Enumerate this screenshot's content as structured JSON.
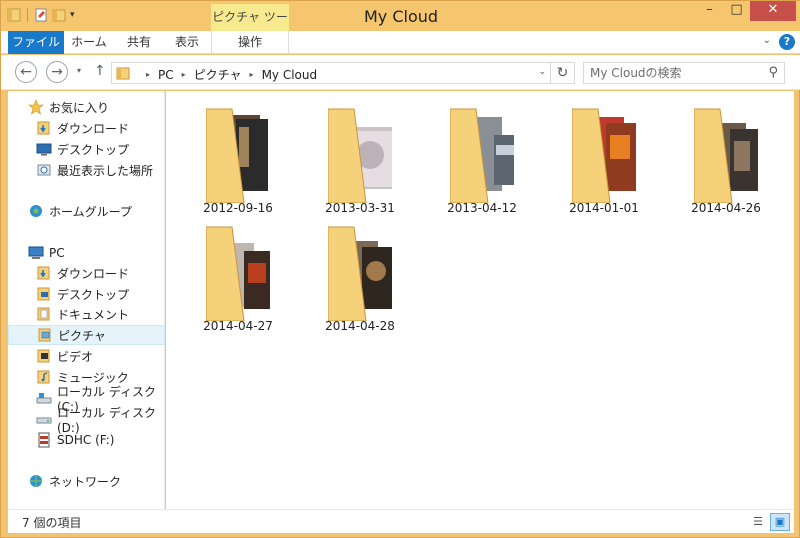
{
  "window": {
    "title": "My Cloud",
    "context_tab_group": "ピクチャ ツール",
    "buttons": {
      "minimize": "–",
      "maximize": "□",
      "close": "✕"
    }
  },
  "quick_access": {
    "dropdown": "▾"
  },
  "ribbon": {
    "tabs": [
      "ファイル",
      "ホーム",
      "共有",
      "表示",
      "操作"
    ],
    "expand": "⌄",
    "help": "?"
  },
  "navigation": {
    "back": "←",
    "forward": "→",
    "recent": "▾",
    "up": "↑",
    "breadcrumb": [
      "PC",
      "ピクチャ",
      "My Cloud"
    ],
    "separator": "▸",
    "address_dropdown": "⌄",
    "refresh": "↻",
    "search_placeholder": "My Cloudの検索",
    "search_icon": "⚲"
  },
  "nav_pane": {
    "favorites": {
      "label": "お気に入り",
      "items": [
        "ダウンロード",
        "デスクトップ",
        "最近表示した場所"
      ]
    },
    "homegroup": {
      "label": "ホームグループ"
    },
    "pc": {
      "label": "PC",
      "items": [
        "ダウンロード",
        "デスクトップ",
        "ドキュメント",
        "ピクチャ",
        "ビデオ",
        "ミュージック",
        "ローカル ディスク (C:)",
        "ローカル ディスク (D:)",
        "SDHC (F:)"
      ],
      "selected": "ピクチャ"
    },
    "network": {
      "label": "ネットワーク"
    }
  },
  "folders": [
    {
      "name": "2012-09-16"
    },
    {
      "name": "2013-03-31"
    },
    {
      "name": "2013-04-12"
    },
    {
      "name": "2014-01-01"
    },
    {
      "name": "2014-04-26"
    },
    {
      "name": "2014-04-27"
    },
    {
      "name": "2014-04-28"
    }
  ],
  "status": {
    "item_count": "7 個の項目",
    "details_view_icon": "☰",
    "large_icons_view_icon": "▣"
  },
  "colors": {
    "title_bar": "#f6c66f",
    "file_tab": "#1979ca",
    "context_tab": "#f7e98d",
    "close_button": "#c7504a",
    "folder": "#f5d27a",
    "selection": "#e5f3fb"
  }
}
